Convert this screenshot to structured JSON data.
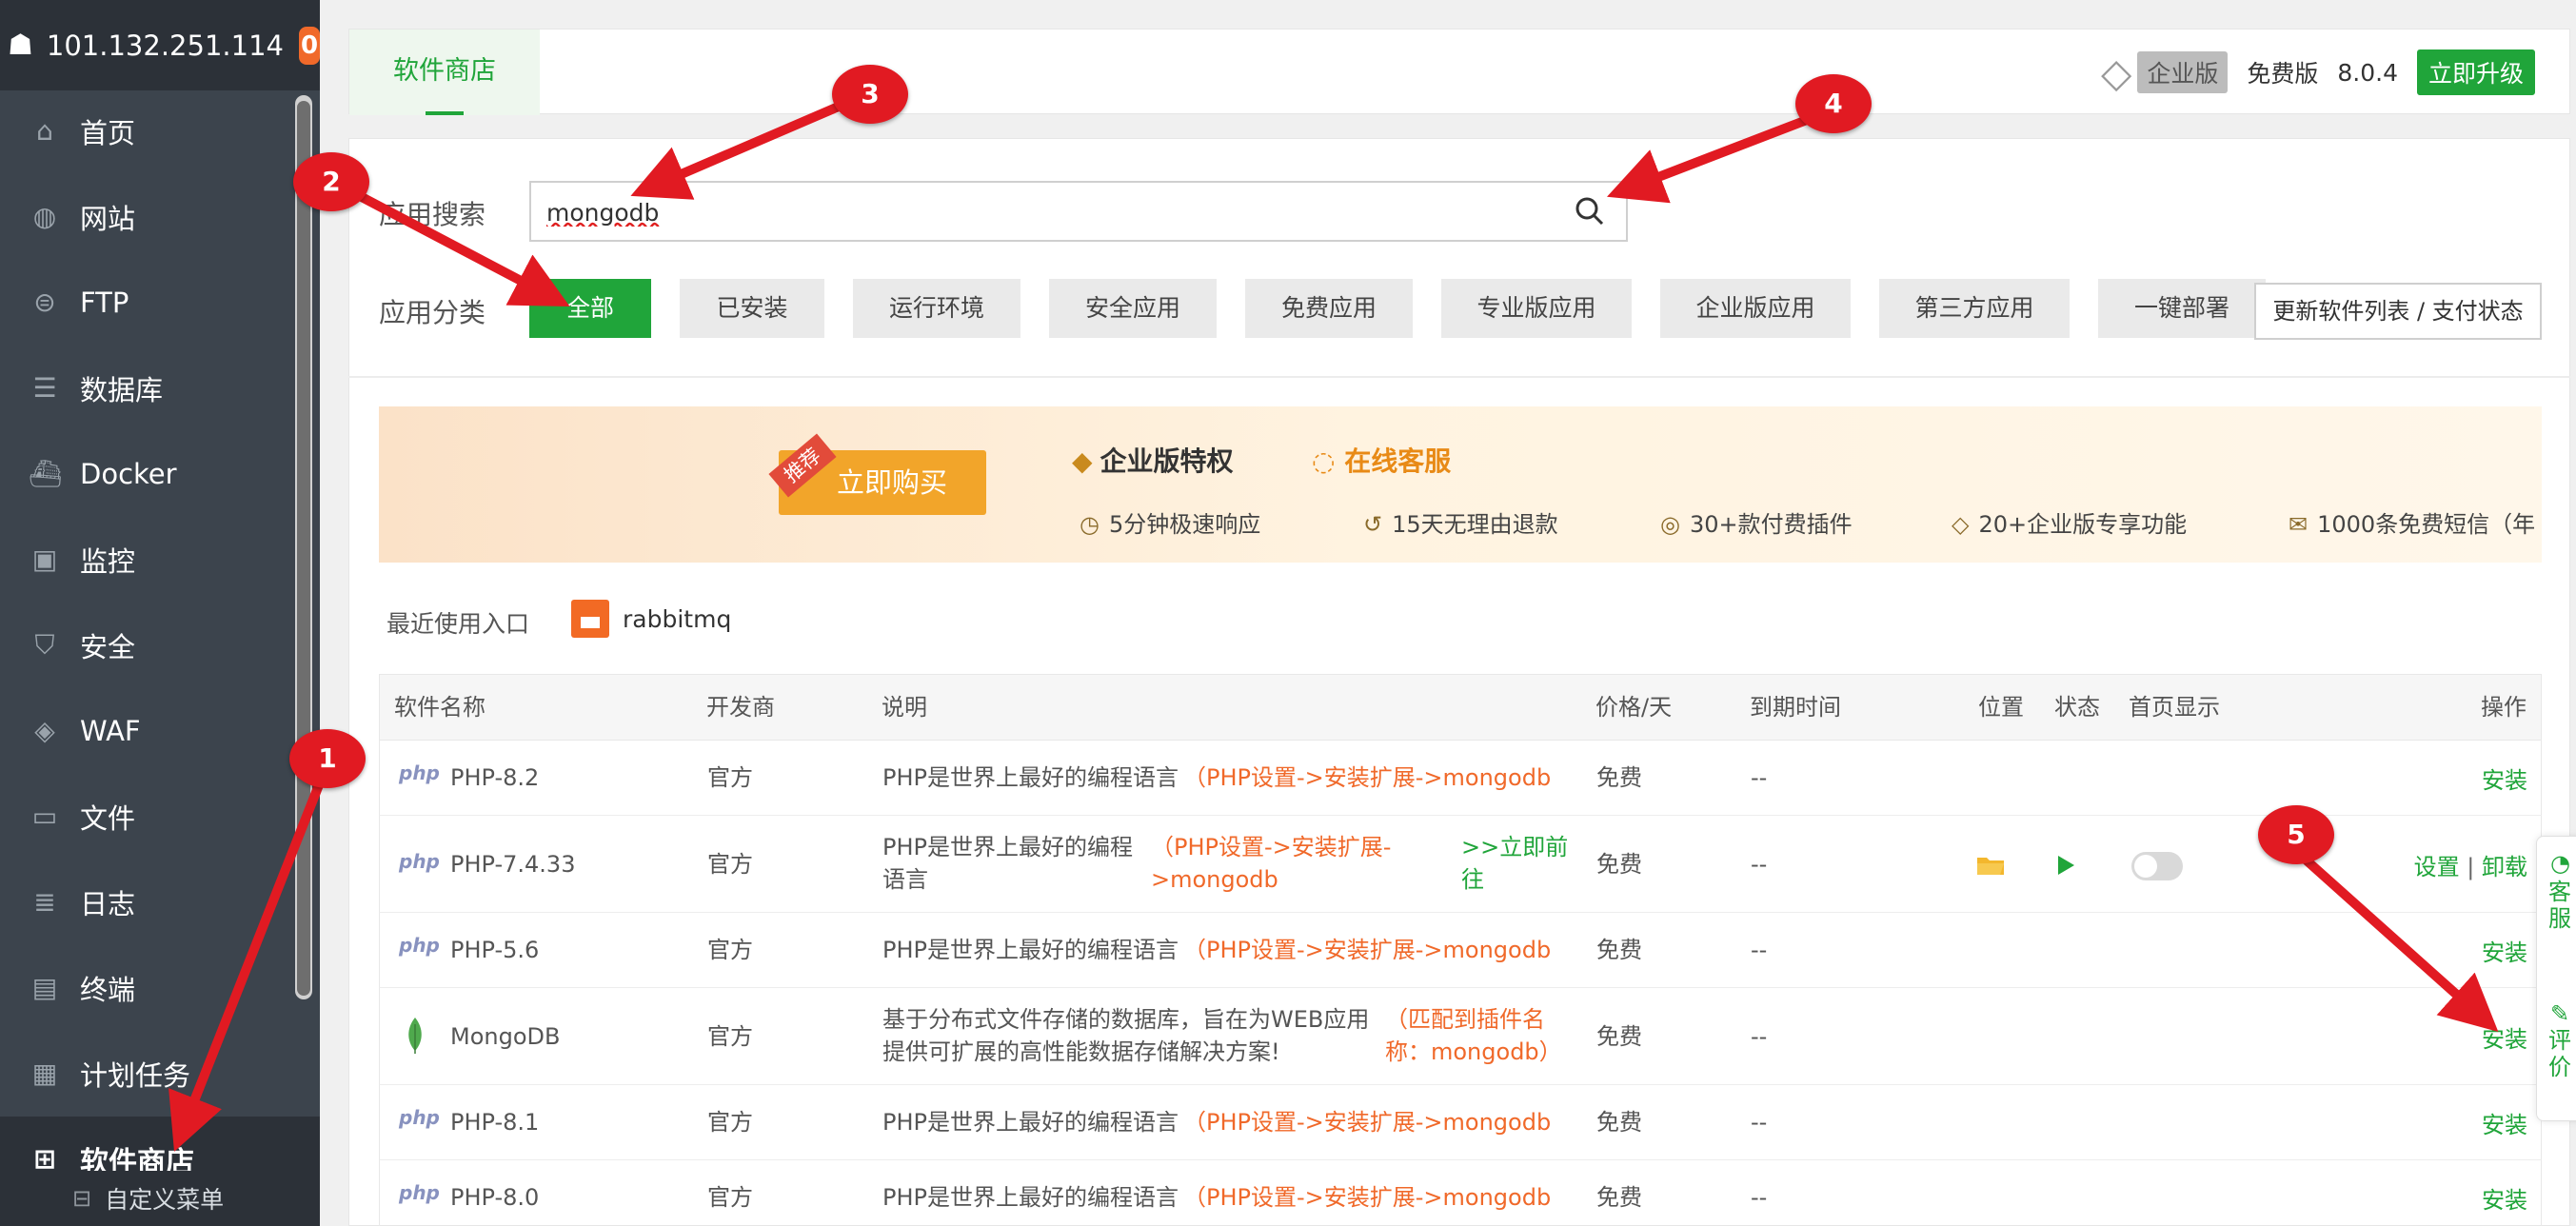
{
  "server": {
    "ip": "101.132.251.114",
    "badge_count": "0"
  },
  "sidebar": {
    "items": [
      {
        "label": "首页",
        "icon": "home-icon"
      },
      {
        "label": "网站",
        "icon": "globe-icon"
      },
      {
        "label": "FTP",
        "icon": "ftp-icon"
      },
      {
        "label": "数据库",
        "icon": "database-icon"
      },
      {
        "label": "Docker",
        "icon": "docker-icon"
      },
      {
        "label": "监控",
        "icon": "monitor-icon"
      },
      {
        "label": "安全",
        "icon": "shield-icon"
      },
      {
        "label": "WAF",
        "icon": "waf-icon"
      },
      {
        "label": "文件",
        "icon": "folder-icon"
      },
      {
        "label": "日志",
        "icon": "log-icon"
      },
      {
        "label": "终端",
        "icon": "terminal-icon"
      },
      {
        "label": "计划任务",
        "icon": "calendar-icon"
      },
      {
        "label": "软件商店",
        "icon": "grid-icon"
      }
    ],
    "sub_item": "自定义菜单"
  },
  "header": {
    "tab": "软件商店",
    "enterprise": "企业版",
    "free": "免费版",
    "version": "8.0.4",
    "upgrade": "立即升级"
  },
  "search": {
    "label": "应用搜索",
    "value": "mongodb"
  },
  "categories": {
    "label": "应用分类",
    "items": [
      "全部",
      "已安装",
      "运行环境",
      "安全应用",
      "免费应用",
      "专业版应用",
      "企业版应用",
      "第三方应用",
      "一键部署"
    ],
    "refresh": "更新软件列表 / 支付状态"
  },
  "banner": {
    "tag": "推荐",
    "buy": "立即购买",
    "title": "企业版特权",
    "service": "在线客服",
    "features": [
      "5分钟极速响应",
      "15天无理由退款",
      "30+款付费插件",
      "20+企业版专享功能",
      "1000条免费短信（年"
    ]
  },
  "recent": {
    "label": "最近使用入口",
    "item": "rabbitmq"
  },
  "table": {
    "headers": [
      "软件名称",
      "开发商",
      "说明",
      "价格/天",
      "到期时间",
      "位置",
      "状态",
      "首页显示",
      "操作"
    ],
    "rows": [
      {
        "name": "PHP-8.2",
        "dev": "官方",
        "desc": "PHP是世界上最好的编程语言",
        "hint": "（PHP设置->安装扩展->mongodb",
        "price": "免费",
        "expire": "--",
        "action": "安装"
      },
      {
        "name": "PHP-7.4.33",
        "dev": "官方",
        "desc1": "PHP是世界上最好的编程",
        "desc2": "语言",
        "hint1": "（PHP设置->安装扩展-",
        "hint2": ">mongodb",
        "go1": ">>立即前",
        "go2": "往",
        "price": "免费",
        "expire": "--",
        "action1": "设置",
        "sep": "|",
        "action2": "卸载"
      },
      {
        "name": "PHP-5.6",
        "dev": "官方",
        "desc": "PHP是世界上最好的编程语言",
        "hint": "（PHP设置->安装扩展->mongodb",
        "price": "免费",
        "expire": "--",
        "action": "安装"
      },
      {
        "name": "MongoDB",
        "dev": "官方",
        "desc1": "基于分布式文件存储的数据库，旨在为WEB应用",
        "desc2": "提供可扩展的高性能数据存储解决方案!",
        "hint1": "（匹配到插件名",
        "hint2": "称：mongodb）",
        "price": "免费",
        "expire": "--",
        "action": "安装"
      },
      {
        "name": "PHP-8.1",
        "dev": "官方",
        "desc": "PHP是世界上最好的编程语言",
        "hint": "（PHP设置->安装扩展->mongodb",
        "price": "免费",
        "expire": "--",
        "action": "安装"
      },
      {
        "name": "PHP-8.0",
        "dev": "官方",
        "desc": "PHP是世界上最好的编程语言",
        "hint": "（PHP设置->安装扩展->mongodb",
        "price": "免费",
        "expire": "--",
        "action": "安装"
      }
    ],
    "php_logo": "php"
  },
  "float_tab": {
    "service": "客服",
    "review": "评价"
  },
  "annotations": [
    "1",
    "2",
    "3",
    "4",
    "5"
  ],
  "colors": {
    "accent": "#20a53a",
    "orange": "#f0692a",
    "sidebar": "#3c444d",
    "marker": "#e11a22"
  }
}
